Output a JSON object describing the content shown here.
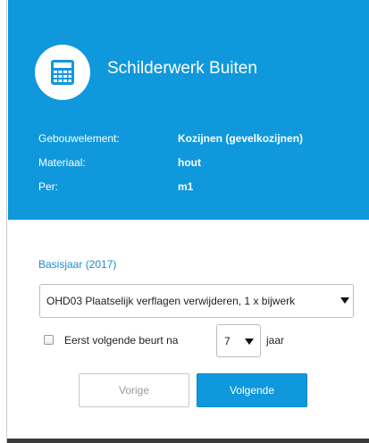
{
  "header": {
    "title": "Schilderwerk Buiten",
    "icon": "calculator-icon",
    "background_color": "#0f98dc"
  },
  "info": [
    {
      "label": "Gebouwelement:",
      "value": "Kozijnen (gevelkozijnen)"
    },
    {
      "label": "Materiaal:",
      "value": "hout"
    },
    {
      "label": "Per:",
      "value": "m1"
    }
  ],
  "section": {
    "basisjaar_label": "Basisjaar (2017)"
  },
  "activity_select": {
    "selected": "OHD03 Plaatselijk verflagen verwijderen, 1 x bijwerk"
  },
  "next_service": {
    "checkbox_label": "Eerst volgende beurt na",
    "checked": false,
    "years_selected": "7",
    "unit_label": "jaar"
  },
  "buttons": {
    "previous": "Vorige",
    "next": "Volgende"
  }
}
